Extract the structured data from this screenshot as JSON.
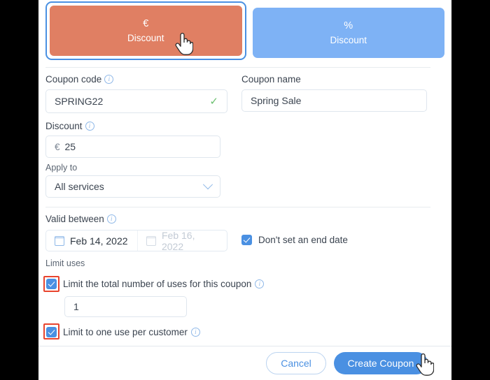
{
  "modal": {
    "type_options": [
      {
        "symbol": "€",
        "label": "Discount",
        "name": "euro-discount",
        "selected": true,
        "color": "#e07f63"
      },
      {
        "symbol": "%",
        "label": "Discount",
        "name": "percent-discount",
        "selected": false,
        "color": "#7eb2f5"
      }
    ],
    "fields": {
      "coupon_code": {
        "label": "Coupon code",
        "value": "SPRING22",
        "valid_mark": "✓"
      },
      "coupon_name": {
        "label": "Coupon name",
        "value": "Spring Sale"
      },
      "discount": {
        "label": "Discount",
        "currency": "€",
        "value": "25"
      },
      "apply_to": {
        "label": "Apply to",
        "value": "All services"
      },
      "valid_between": {
        "label": "Valid between",
        "start_date": "Feb 14, 2022",
        "end_date": "Feb 16, 2022",
        "no_end_date_label": "Don't set an end date",
        "no_end_date_checked": true
      },
      "limit_uses": {
        "section_label": "Limit uses",
        "total_uses_label": "Limit the total number of uses for this coupon",
        "total_uses_checked": true,
        "total_uses_value": "1",
        "per_customer_label": "Limit to one use per customer",
        "per_customer_checked": true
      }
    },
    "footer": {
      "cancel_label": "Cancel",
      "submit_label": "Create Coupon"
    }
  },
  "colors": {
    "accent_blue": "#4a90e2",
    "tile_orange": "#e07f63",
    "tile_blue": "#7eb2f5",
    "annotation_red": "#e8442e",
    "valid_green": "#6cc070",
    "scrollbar": "#d4e6fb"
  }
}
